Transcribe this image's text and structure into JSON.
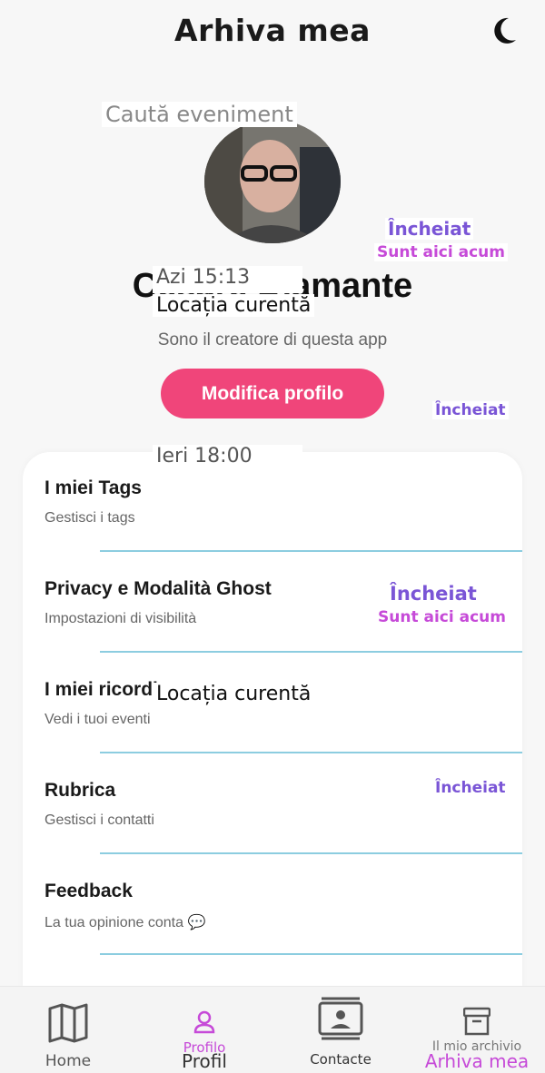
{
  "header": {
    "title": "Arhiva mea",
    "theme_icon": "moon-icon"
  },
  "search": {
    "placeholder": "Caută eveniment"
  },
  "profile": {
    "name": "Cesare Diamante",
    "bio": "Sono il creatore di questa app",
    "edit_label": "Modifica profilo",
    "avatar": "avatar-photo"
  },
  "overlays": {
    "time_today": "Azi 15:13",
    "location_current": "Locația curentă",
    "time_yesterday": "Ieri 18:00",
    "status_ended": "Încheiat",
    "here_now": "Sunt aici acum"
  },
  "menu": [
    {
      "title": "I miei Tags",
      "subtitle": "Gestisci i tags"
    },
    {
      "title": "Privacy e Modalità Ghost",
      "subtitle": "Impostazioni di visibilità"
    },
    {
      "title": "I miei ricordi",
      "subtitle": "Vedi i tuoi eventi"
    },
    {
      "title": "Rubrica",
      "subtitle": "Gestisci i contatti"
    },
    {
      "title": "Feedback",
      "subtitle": "La tua opinione conta 💬"
    }
  ],
  "nav": {
    "home": "Home",
    "profile": "Profilo",
    "profile_overlay": "Profil",
    "contacts": "Contacte",
    "archive": "Arhiva mea",
    "archive_under": "Il mio archivio"
  },
  "colors": {
    "accent": "#f0457a",
    "active_tab": "#c64ad8",
    "status": "#7a55d6",
    "divider": "#8ccde0"
  }
}
